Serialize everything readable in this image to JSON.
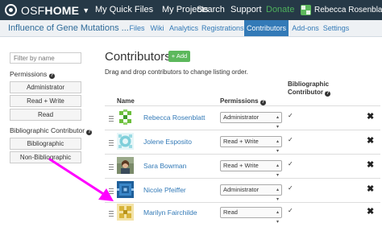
{
  "topnav": {
    "brand_osf": "OSF",
    "brand_home": "HOME",
    "links": {
      "quick_files": "My Quick Files",
      "projects": "My Projects",
      "search": "Search",
      "support": "Support",
      "donate": "Donate"
    },
    "user_name": "Rebecca Rosenblatt"
  },
  "subnav": {
    "project_title": "Influence of Gene Mutations ...",
    "tabs": [
      "Files",
      "Wiki",
      "Analytics",
      "Registrations",
      "Contributors",
      "Add-ons",
      "Settings"
    ],
    "active_tab": "Contributors"
  },
  "sidebar": {
    "filter_placeholder": "Filter by name",
    "permissions_label": "Permissions",
    "permission_filters": [
      "Administrator",
      "Read + Write",
      "Read"
    ],
    "bib_label": "Bibliographic Contributor",
    "bib_filters": [
      "Bibliographic",
      "Non-Bibliographic"
    ]
  },
  "main": {
    "heading": "Contributors",
    "add_label": "+ Add",
    "subtitle": "Drag and drop contributors to change listing order.",
    "columns": {
      "name": "Name",
      "permissions": "Permissions",
      "bibliographic_line1": "Bibliographic",
      "bibliographic_line2": "Contributor"
    },
    "contributors": [
      {
        "name": "Rebecca Rosenblatt",
        "permission": "Administrator",
        "bibliographic": "✓"
      },
      {
        "name": "Jolene Esposito",
        "permission": "Read + Write",
        "bibliographic": "✓"
      },
      {
        "name": "Sara Bowman",
        "permission": "Read + Write",
        "bibliographic": "✓"
      },
      {
        "name": "Nicole Pfeiffer",
        "permission": "Administrator",
        "bibliographic": "✓"
      },
      {
        "name": "Marilyn Fairchilde",
        "permission": "Read",
        "bibliographic": "✓"
      }
    ],
    "remove_label": "✖"
  },
  "colors": {
    "topnav_bg": "#263947",
    "active_tab": "#337ab7",
    "add_button": "#5cb85c",
    "donate": "#4eb05c",
    "annotation_arrow": "#ff00ff"
  }
}
